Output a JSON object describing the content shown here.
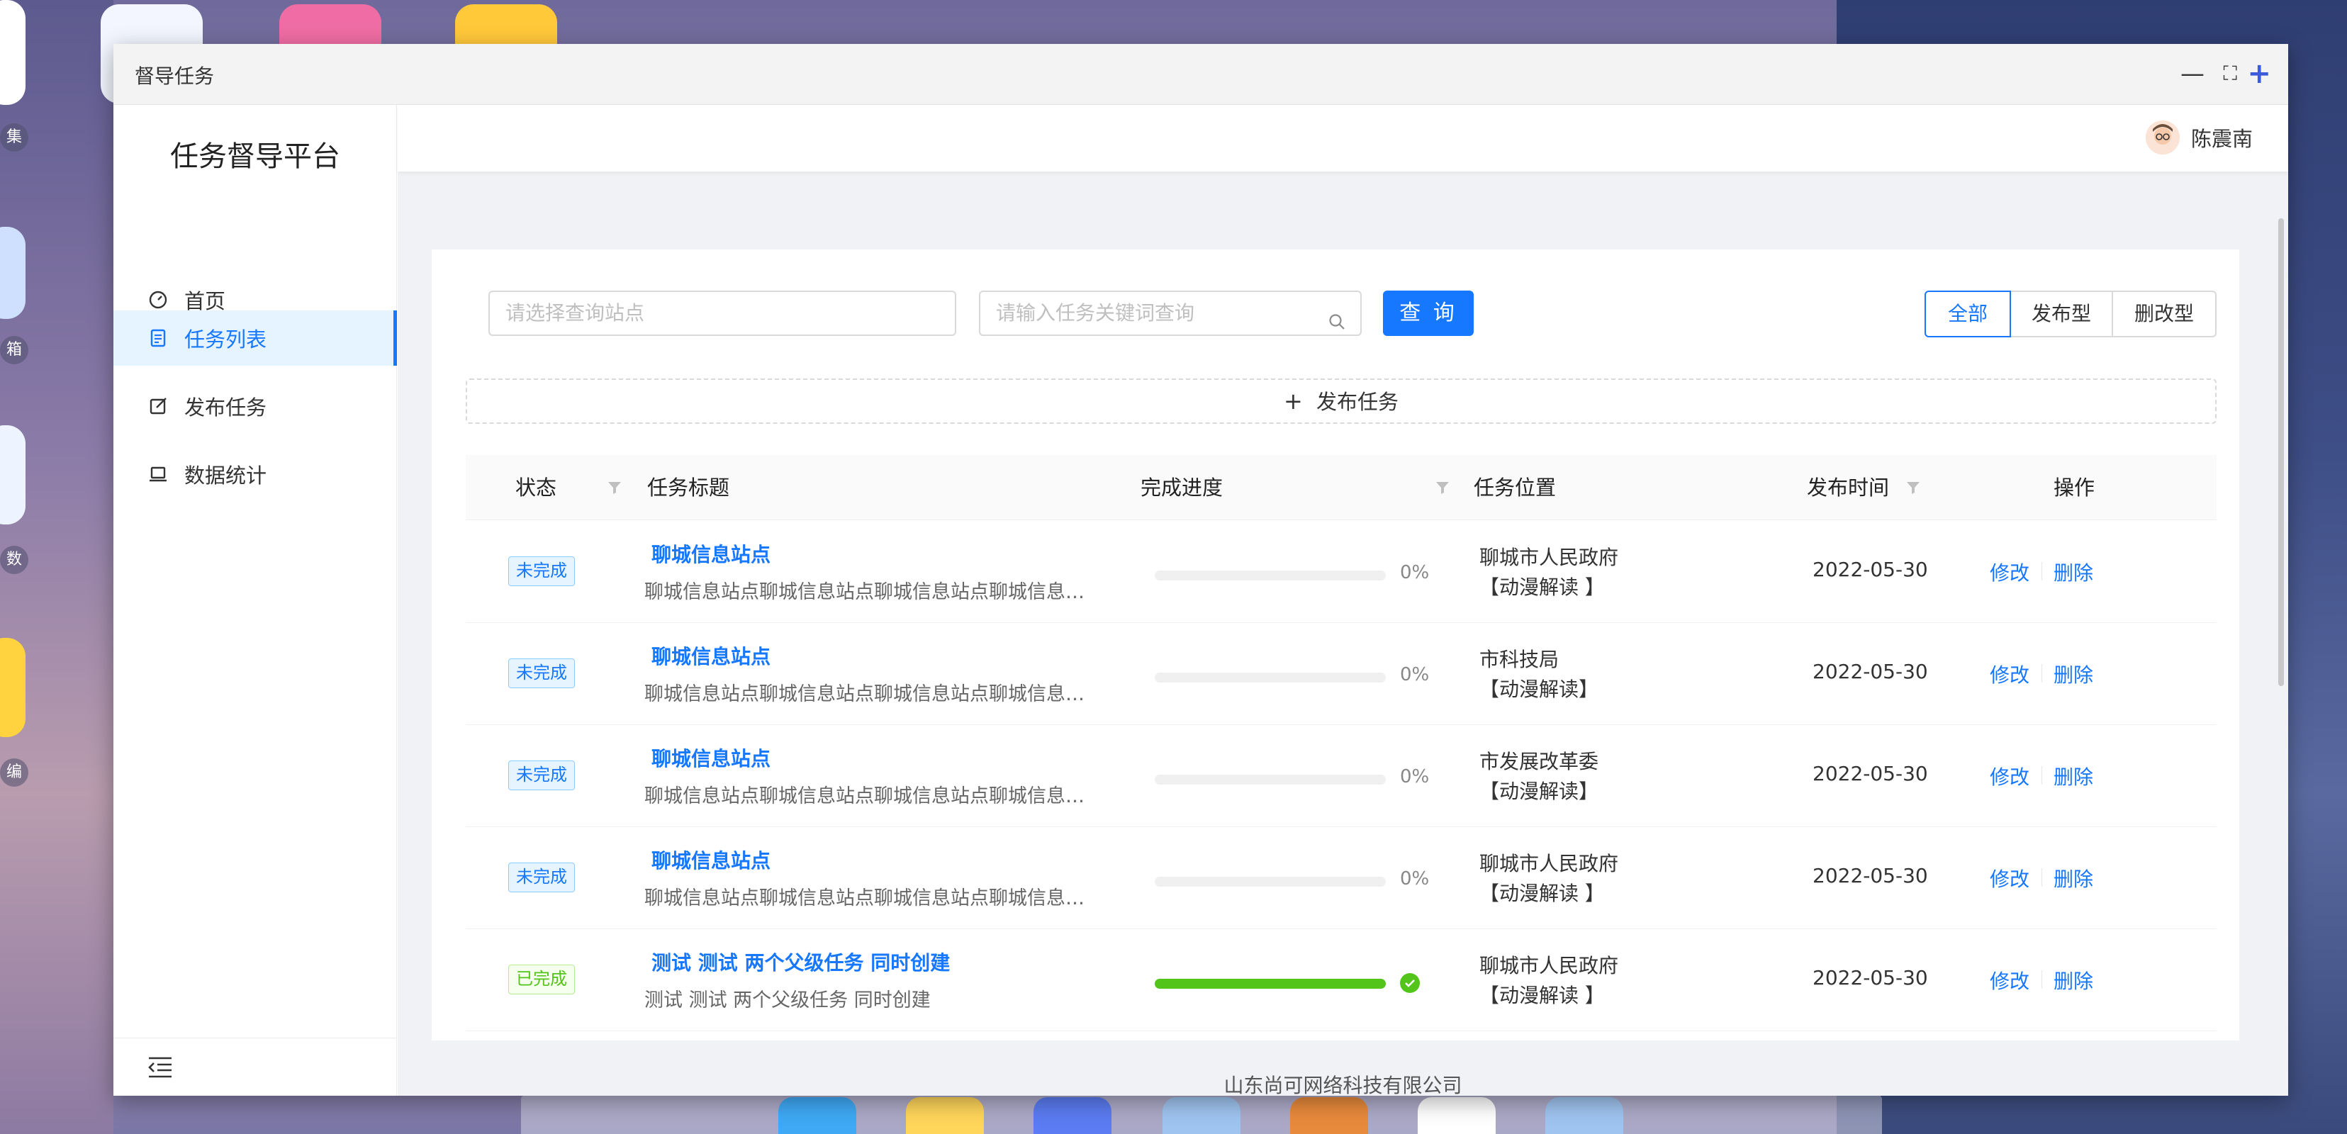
{
  "window": {
    "title": "督导任务",
    "minimize_glyph": "—",
    "expand_glyph": "⛶",
    "add_glyph": "+"
  },
  "sidebar": {
    "brand": "任务督导平台",
    "items": [
      {
        "label": "首页",
        "icon": "dashboard-icon"
      },
      {
        "label": "任务列表",
        "icon": "list-icon",
        "active": true
      },
      {
        "label": "发布任务",
        "icon": "edit-icon"
      },
      {
        "label": "数据统计",
        "icon": "laptop-icon"
      }
    ],
    "collapse_icon": "menu-fold-icon"
  },
  "header": {
    "user_name": "陈震南"
  },
  "toolbar": {
    "site_placeholder": "请选择查询站点",
    "keyword_placeholder": "请输入任务关键词查询",
    "query_label": "查 询",
    "filters": [
      "全部",
      "发布型",
      "删改型"
    ],
    "active_filter": "全部"
  },
  "publish_label": "发布任务",
  "table": {
    "columns": [
      "状态",
      "任务标题",
      "完成进度",
      "任务位置",
      "发布时间",
      "操作"
    ],
    "rows": [
      {
        "status": "未完成",
        "status_type": "todo",
        "title": "聊城信息站点",
        "desc": "聊城信息站点聊城信息站点聊城信息站点聊城信息站点聊城信息站点",
        "progress": 0,
        "progress_text": "0%",
        "loc1": "聊城市人民政府",
        "loc2": "【动漫解读 】",
        "date": "2022-05-30",
        "edit": "修改",
        "delete": "删除"
      },
      {
        "status": "未完成",
        "status_type": "todo",
        "title": "聊城信息站点",
        "desc": "聊城信息站点聊城信息站点聊城信息站点聊城信息站点聊城信息站点",
        "progress": 0,
        "progress_text": "0%",
        "loc1": "市科技局",
        "loc2": "【动漫解读】",
        "date": "2022-05-30",
        "edit": "修改",
        "delete": "删除"
      },
      {
        "status": "未完成",
        "status_type": "todo",
        "title": "聊城信息站点",
        "desc": "聊城信息站点聊城信息站点聊城信息站点聊城信息站点聊城信息站点",
        "progress": 0,
        "progress_text": "0%",
        "loc1": "市发展改革委",
        "loc2": "【动漫解读】",
        "date": "2022-05-30",
        "edit": "修改",
        "delete": "删除"
      },
      {
        "status": "未完成",
        "status_type": "todo",
        "title": "聊城信息站点",
        "desc": "聊城信息站点聊城信息站点聊城信息站点聊城信息站点聊城信息站点",
        "progress": 0,
        "progress_text": "0%",
        "loc1": "聊城市人民政府",
        "loc2": "【动漫解读 】",
        "date": "2022-05-30",
        "edit": "修改",
        "delete": "删除"
      },
      {
        "status": "已完成",
        "status_type": "done",
        "title": "测试 测试 两个父级任务 同时创建",
        "desc": "测试 测试 两个父级任务 同时创建",
        "progress": 100,
        "progress_text": "",
        "loc1": "聊城市人民政府",
        "loc2": "【动漫解读 】",
        "date": "2022-05-30",
        "edit": "修改",
        "delete": "删除"
      }
    ]
  },
  "footer": "山东尚可网络科技有限公司",
  "desktop_labels": [
    "集",
    "箱",
    "数",
    "编"
  ],
  "colors": {
    "primary": "#1677ff",
    "success": "#52c41a",
    "active_bg": "#e6f4ff"
  }
}
